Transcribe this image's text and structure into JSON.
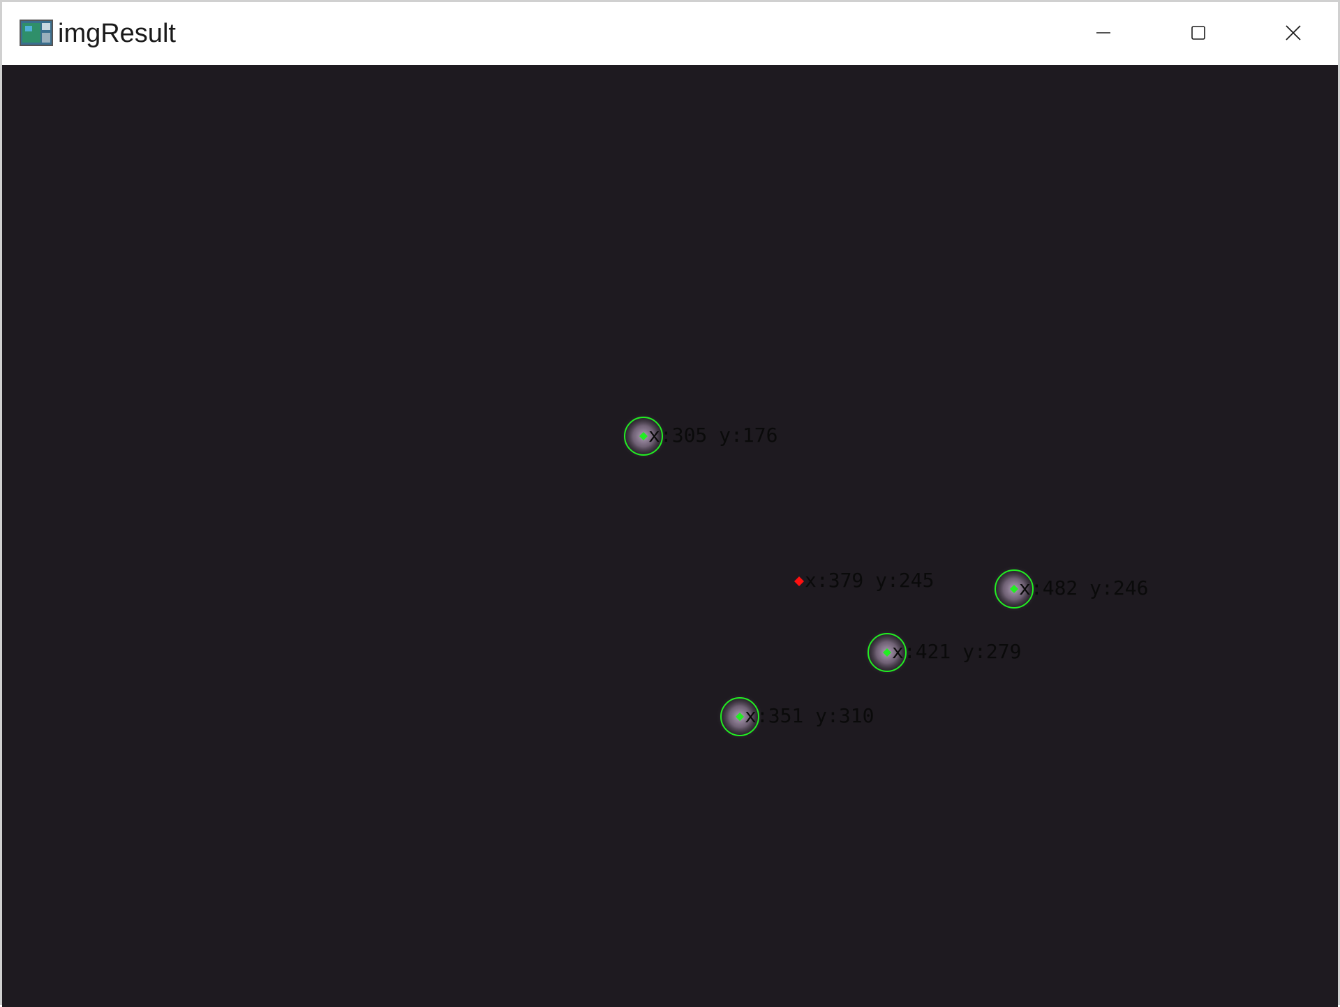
{
  "window": {
    "title": "imgResult",
    "controls": {
      "minimize": "minimize-icon",
      "maximize": "maximize-icon",
      "close": "close-icon"
    }
  },
  "colors": {
    "canvas_background": "#1e1a20",
    "circle": "#22ee22",
    "center_marker_detected": "#22ee22",
    "center_marker_computed": "#ff1010",
    "label_text": "#0a0a0a"
  },
  "detections": [
    {
      "label": "x:305 y:176",
      "type": "detected"
    },
    {
      "label": "x:482 y:246",
      "type": "detected"
    },
    {
      "label": "x:421 y:279",
      "type": "detected"
    },
    {
      "label": "x:351 y:310",
      "type": "detected"
    }
  ],
  "centroid": {
    "label": "x:379 y:245",
    "type": "computed"
  }
}
